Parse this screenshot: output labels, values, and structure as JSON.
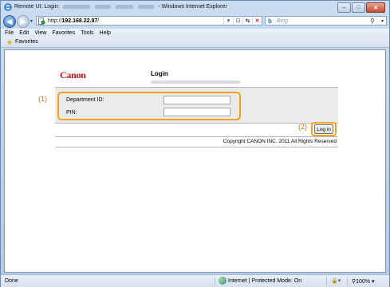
{
  "window": {
    "title_prefix": "Remote UI: Login:",
    "title_suffix": "- Windows Internet Explorer",
    "minimize": "–",
    "maximize": "□",
    "close": "✕"
  },
  "navbar": {
    "back": "◀",
    "forward": "▶",
    "dropdown": "▾",
    "url": "http://192.168.22.87/",
    "url_host": "192.168.22.87",
    "url_scheme": "http://",
    "url_path": "/",
    "tools": [
      "▾",
      "⊡",
      "↹",
      "✕"
    ],
    "search_logo": "b",
    "search_placeholder": "Bing",
    "search_icon": "⚲",
    "search_dropdown": "▾"
  },
  "menu": [
    "File",
    "Edit",
    "View",
    "Favorites",
    "Tools",
    "Help"
  ],
  "favorites": {
    "label": "Favorites",
    "icon": "star-icon"
  },
  "page": {
    "logo_text": "Canon",
    "title": "Login",
    "fields": {
      "department_label": "Department ID:",
      "department_value": "",
      "pin_label": "PIN:",
      "pin_value": ""
    },
    "login_button": "Log in",
    "copyright": "Copyright CANON INC. 2011 All Rights Reserved",
    "callout_1": "(1)",
    "callout_2": "(2)",
    "accent_color": "#f3a21e",
    "logo_color": "#c8161d"
  },
  "status": {
    "left": "Done",
    "zone": "Internet | Protected Mode: On",
    "zoom": "100%",
    "zoom_caret": "▾",
    "protect_caret": "▾"
  }
}
